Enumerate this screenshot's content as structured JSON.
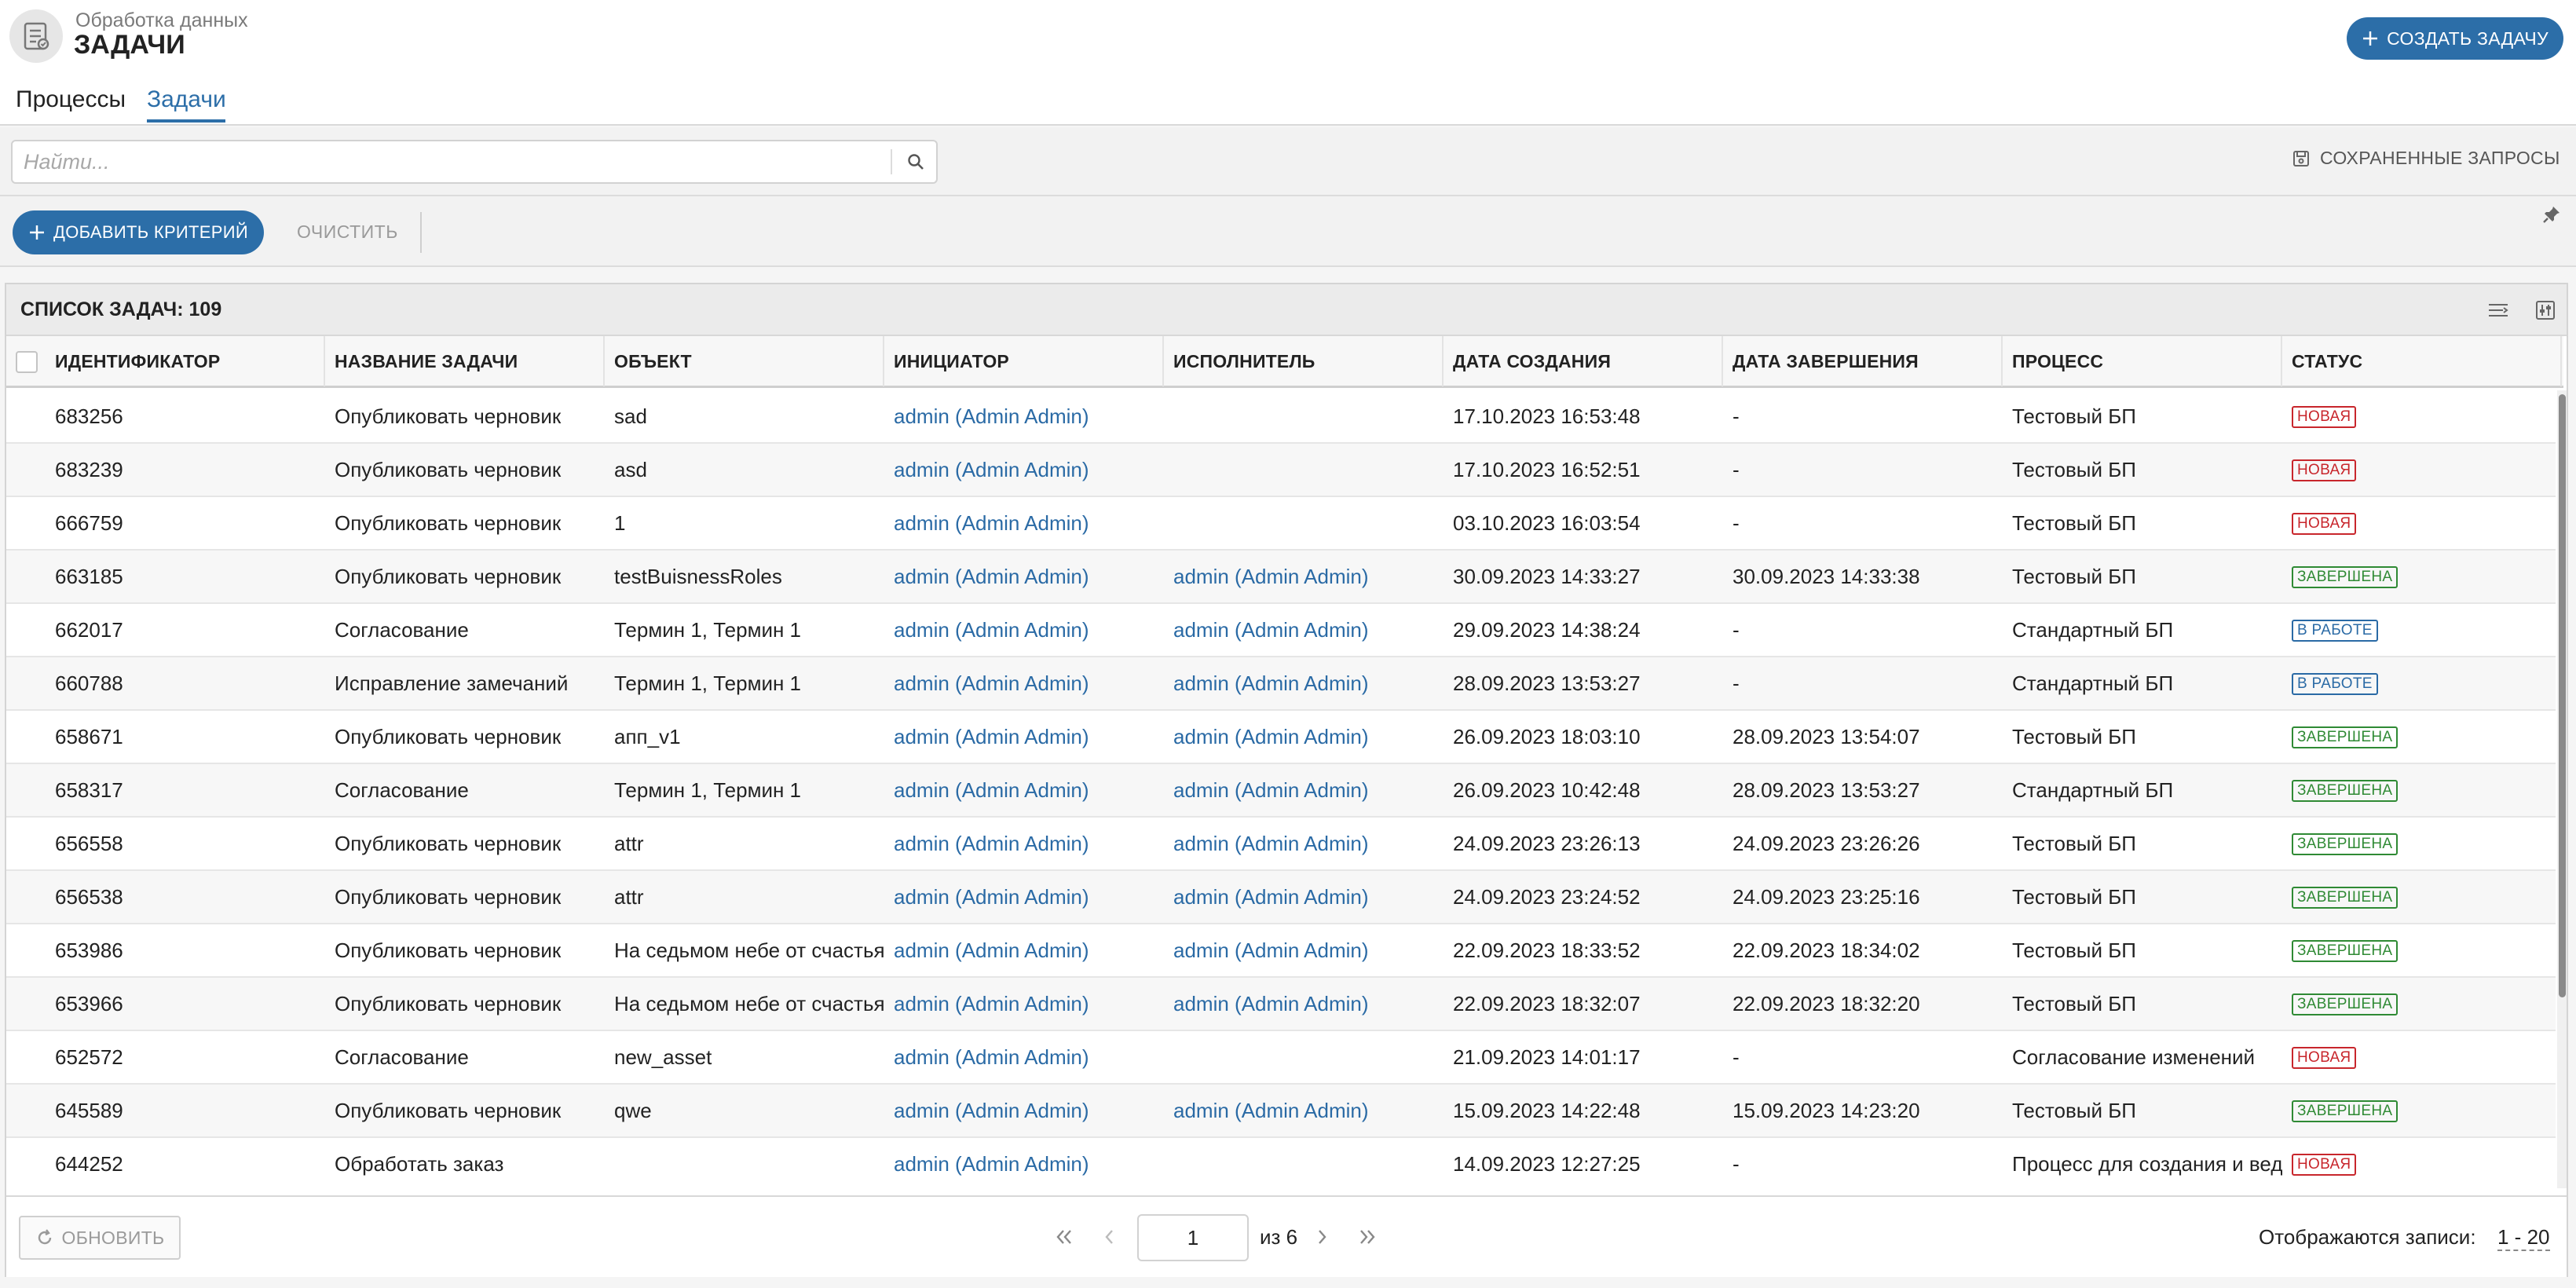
{
  "header": {
    "subtitle": "Обработка данных",
    "title": "ЗАДАЧИ",
    "create_button": "СОЗДАТЬ ЗАДАЧУ",
    "app_icon": "checklist-icon"
  },
  "tabs": [
    {
      "label": "Процессы",
      "active": false
    },
    {
      "label": "Задачи",
      "active": true
    }
  ],
  "search": {
    "placeholder": "Найти...",
    "value": "",
    "saved_queries_label": "СОХРАНЕННЫЕ ЗАПРОСЫ"
  },
  "criteria": {
    "add_label": "ДОБАВИТЬ КРИТЕРИЙ",
    "clear_label": "ОЧИСТИТЬ"
  },
  "panel": {
    "title": "СПИСОК ЗАДАЧ: 109"
  },
  "columns": [
    "ИДЕНТИФИКАТОР",
    "НАЗВАНИЕ ЗАДАЧИ",
    "ОБЪЕКТ",
    "ИНИЦИАТОР",
    "ИСПОЛНИТЕЛЬ",
    "ДАТА СОЗДАНИЯ",
    "ДАТА ЗАВЕРШЕНИЯ",
    "ПРОЦЕСС",
    "СТАТУС"
  ],
  "status_colors": {
    "new": "#c8262c",
    "done": "#2f8a34",
    "work": "#2a6aa5"
  },
  "rows": [
    {
      "id": "683256",
      "name": "Опубликовать черновик",
      "object": "sad",
      "initiator": "admin (Admin Admin)",
      "assignee": "",
      "created": "17.10.2023 16:53:48",
      "completed": "-",
      "process": "Тестовый БП",
      "status": "НОВАЯ",
      "status_type": "new"
    },
    {
      "id": "683239",
      "name": "Опубликовать черновик",
      "object": "asd",
      "initiator": "admin (Admin Admin)",
      "assignee": "",
      "created": "17.10.2023 16:52:51",
      "completed": "-",
      "process": "Тестовый БП",
      "status": "НОВАЯ",
      "status_type": "new"
    },
    {
      "id": "666759",
      "name": "Опубликовать черновик",
      "object": "1",
      "initiator": "admin (Admin Admin)",
      "assignee": "",
      "created": "03.10.2023 16:03:54",
      "completed": "-",
      "process": "Тестовый БП",
      "status": "НОВАЯ",
      "status_type": "new"
    },
    {
      "id": "663185",
      "name": "Опубликовать черновик",
      "object": "testBuisnessRoles",
      "initiator": "admin (Admin Admin)",
      "assignee": "admin (Admin Admin)",
      "created": "30.09.2023 14:33:27",
      "completed": "30.09.2023 14:33:38",
      "process": "Тестовый БП",
      "status": "ЗАВЕРШЕНА",
      "status_type": "done"
    },
    {
      "id": "662017",
      "name": "Согласование",
      "object": "Термин 1, Термин 1",
      "initiator": "admin (Admin Admin)",
      "assignee": "admin (Admin Admin)",
      "created": "29.09.2023 14:38:24",
      "completed": "-",
      "process": "Стандартный БП",
      "status": "В РАБОТЕ",
      "status_type": "work"
    },
    {
      "id": "660788",
      "name": "Исправление замечаний",
      "object": "Термин 1, Термин 1",
      "initiator": "admin (Admin Admin)",
      "assignee": "admin (Admin Admin)",
      "created": "28.09.2023 13:53:27",
      "completed": "-",
      "process": "Стандартный БП",
      "status": "В РАБОТЕ",
      "status_type": "work"
    },
    {
      "id": "658671",
      "name": "Опубликовать черновик",
      "object": "апп_v1",
      "initiator": "admin (Admin Admin)",
      "assignee": "admin (Admin Admin)",
      "created": "26.09.2023 18:03:10",
      "completed": "28.09.2023 13:54:07",
      "process": "Тестовый БП",
      "status": "ЗАВЕРШЕНА",
      "status_type": "done"
    },
    {
      "id": "658317",
      "name": "Согласование",
      "object": "Термин 1, Термин 1",
      "initiator": "admin (Admin Admin)",
      "assignee": "admin (Admin Admin)",
      "created": "26.09.2023 10:42:48",
      "completed": "28.09.2023 13:53:27",
      "process": "Стандартный БП",
      "status": "ЗАВЕРШЕНА",
      "status_type": "done"
    },
    {
      "id": "656558",
      "name": "Опубликовать черновик",
      "object": "attr",
      "initiator": "admin (Admin Admin)",
      "assignee": "admin (Admin Admin)",
      "created": "24.09.2023 23:26:13",
      "completed": "24.09.2023 23:26:26",
      "process": "Тестовый БП",
      "status": "ЗАВЕРШЕНА",
      "status_type": "done"
    },
    {
      "id": "656538",
      "name": "Опубликовать черновик",
      "object": "attr",
      "initiator": "admin (Admin Admin)",
      "assignee": "admin (Admin Admin)",
      "created": "24.09.2023 23:24:52",
      "completed": "24.09.2023 23:25:16",
      "process": "Тестовый БП",
      "status": "ЗАВЕРШЕНА",
      "status_type": "done"
    },
    {
      "id": "653986",
      "name": "Опубликовать черновик",
      "object": "На седьмом небе от счастья",
      "initiator": "admin (Admin Admin)",
      "assignee": "admin (Admin Admin)",
      "created": "22.09.2023 18:33:52",
      "completed": "22.09.2023 18:34:02",
      "process": "Тестовый БП",
      "status": "ЗАВЕРШЕНА",
      "status_type": "done"
    },
    {
      "id": "653966",
      "name": "Опубликовать черновик",
      "object": "На седьмом небе от счастья",
      "initiator": "admin (Admin Admin)",
      "assignee": "admin (Admin Admin)",
      "created": "22.09.2023 18:32:07",
      "completed": "22.09.2023 18:32:20",
      "process": "Тестовый БП",
      "status": "ЗАВЕРШЕНА",
      "status_type": "done"
    },
    {
      "id": "652572",
      "name": "Согласование",
      "object": "new_asset",
      "initiator": "admin (Admin Admin)",
      "assignee": "",
      "created": "21.09.2023 14:01:17",
      "completed": "-",
      "process": "Согласование изменений",
      "status": "НОВАЯ",
      "status_type": "new"
    },
    {
      "id": "645589",
      "name": "Опубликовать черновик",
      "object": "qwe",
      "initiator": "admin (Admin Admin)",
      "assignee": "admin (Admin Admin)",
      "created": "15.09.2023 14:22:48",
      "completed": "15.09.2023 14:23:20",
      "process": "Тестовый БП",
      "status": "ЗАВЕРШЕНА",
      "status_type": "done"
    },
    {
      "id": "644252",
      "name": "Обработать заказ",
      "object": "",
      "initiator": "admin (Admin Admin)",
      "assignee": "",
      "created": "14.09.2023 12:27:25",
      "completed": "-",
      "process": "Процесс для создания и вед",
      "status": "НОВАЯ",
      "status_type": "new"
    }
  ],
  "footer": {
    "refresh_label": "ОБНОВИТЬ",
    "page": "1",
    "of_pages": "из 6",
    "records_label": "Отображаются записи:",
    "records_range": "1 - 20"
  }
}
